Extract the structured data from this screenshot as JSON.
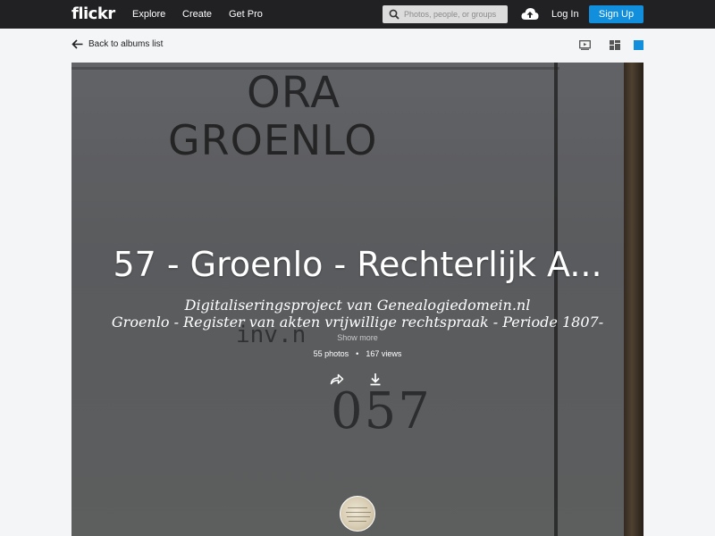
{
  "nav": {
    "logo": "flickr",
    "links": [
      "Explore",
      "Create",
      "Get Pro"
    ],
    "search_placeholder": "Photos, people, or groups",
    "login": "Log In",
    "signup": "Sign Up"
  },
  "subnav": {
    "back_label": "Back to albums list"
  },
  "hero": {
    "stamp_line1": "ORA",
    "stamp_line2": "GROENLO",
    "stamp_inv": "inv.n",
    "stamp_number": "057"
  },
  "album": {
    "title": "57 - Groenlo - Rechterlijk A...",
    "description_line1": "Digitaliseringsproject van Genealogiedomein.nl",
    "description_line2": "Groenlo - Register van akten vrijwillige rechtspraak - Periode 1807-",
    "show_more": "Show more",
    "photos": "55 photos",
    "separator": "•",
    "views": "167 views"
  },
  "icons": {
    "search": "search-icon",
    "upload": "cloud-upload-icon",
    "back": "arrow-left-icon",
    "slideshow": "slideshow-icon",
    "layout": "layout-grid-icon",
    "square": "square-view-icon",
    "share": "share-icon",
    "download": "download-icon"
  },
  "colors": {
    "nav_bg": "#212124",
    "accent": "#128fdc"
  }
}
